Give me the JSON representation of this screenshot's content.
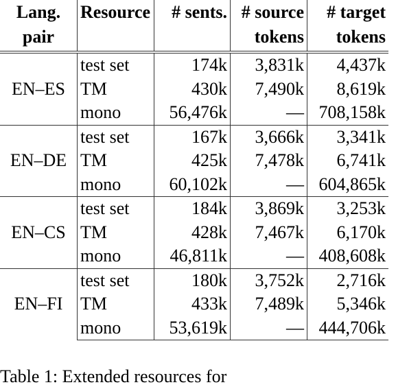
{
  "table": {
    "headers": [
      {
        "line1": "Lang.",
        "line2": "pair"
      },
      {
        "line1": "Resource",
        "line2": ""
      },
      {
        "line1": "# sents.",
        "line2": ""
      },
      {
        "line1": "# source",
        "line2": "tokens"
      },
      {
        "line1": "# target",
        "line2": "tokens"
      }
    ],
    "groups": [
      {
        "pair": "EN–ES",
        "rows": [
          {
            "resource": "test set",
            "sents": "174k",
            "source": "3,831k",
            "target": "4,437k"
          },
          {
            "resource": "TM",
            "sents": "430k",
            "source": "7,490k",
            "target": "8,619k"
          },
          {
            "resource": "mono",
            "sents": "56,476k",
            "source": "—",
            "target": "708,158k"
          }
        ]
      },
      {
        "pair": "EN–DE",
        "rows": [
          {
            "resource": "test set",
            "sents": "167k",
            "source": "3,666k",
            "target": "3,341k"
          },
          {
            "resource": "TM",
            "sents": "425k",
            "source": "7,478k",
            "target": "6,741k"
          },
          {
            "resource": "mono",
            "sents": "60,102k",
            "source": "—",
            "target": "604,865k"
          }
        ]
      },
      {
        "pair": "EN–CS",
        "rows": [
          {
            "resource": "test set",
            "sents": "184k",
            "source": "3,869k",
            "target": "3,253k"
          },
          {
            "resource": "TM",
            "sents": "428k",
            "source": "7,467k",
            "target": "6,170k"
          },
          {
            "resource": "mono",
            "sents": "46,811k",
            "source": "—",
            "target": "408,608k"
          }
        ]
      },
      {
        "pair": "EN–FI",
        "rows": [
          {
            "resource": "test set",
            "sents": "180k",
            "source": "3,752k",
            "target": "2,716k"
          },
          {
            "resource": "TM",
            "sents": "433k",
            "source": "7,489k",
            "target": "5,346k"
          },
          {
            "resource": "mono",
            "sents": "53,619k",
            "source": "—",
            "target": "444,706k"
          }
        ]
      }
    ]
  },
  "caption": "Table 1: Extended resources for"
}
